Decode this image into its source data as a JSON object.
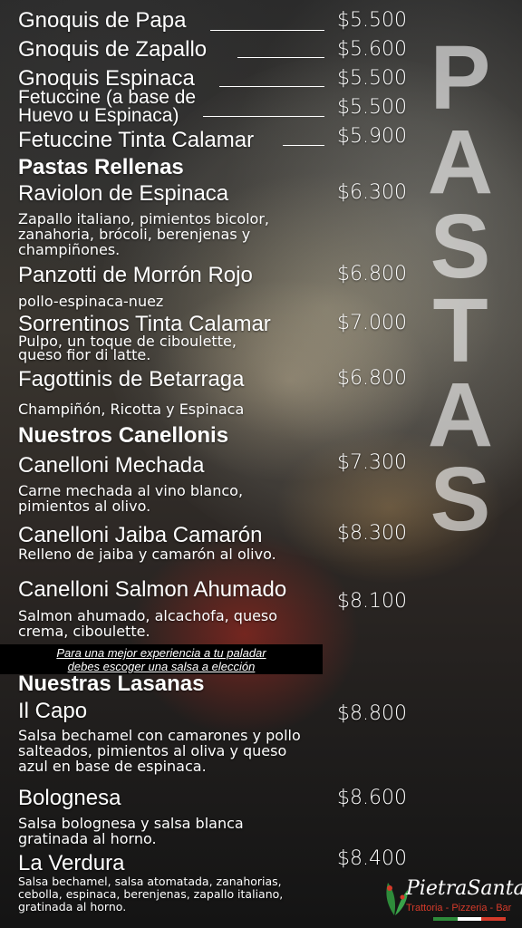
{
  "side_title": [
    "P",
    "A",
    "S",
    "T",
    "A",
    "S"
  ],
  "items": [
    {
      "name": "Gnoquis de Papa",
      "price": "$5.500"
    },
    {
      "name": "Gnoquis de Zapallo",
      "price": "$5.600"
    },
    {
      "name": "Gnoquis Espinaca",
      "price": "$5.500"
    },
    {
      "name": "Fetuccine (a base de\nHuevo u Espinaca)",
      "price": "$5.500"
    },
    {
      "name": "Fetuccine Tinta Calamar",
      "price": "$5.900"
    }
  ],
  "sections": {
    "rellenas": "Pastas Rellenas",
    "canellonis": "Nuestros Canellonis",
    "lasanas": "Nuestras Lasanas"
  },
  "rellenas_items": [
    {
      "name": "Raviolon de Espinaca",
      "price": "$6.300",
      "desc": "Zapallo italiano, pimientos bicolor,\nzanahoria, brócoli, berenjenas y\nchampiñones."
    },
    {
      "name": "Panzotti de Morrón Rojo",
      "price": "$6.800",
      "desc": "pollo-espinaca-nuez"
    },
    {
      "name": "Sorrentinos Tinta Calamar",
      "price": "$7.000",
      "desc": "Pulpo, un toque de ciboulette,\nqueso fior di latte."
    },
    {
      "name": "Fagottinis de Betarraga",
      "price": "$6.800",
      "desc": "Champiñón, Ricotta y Espinaca"
    }
  ],
  "canellonis_items": [
    {
      "name": "Canelloni Mechada",
      "price": "$7.300",
      "desc": "Carne mechada al vino blanco,\npimientos al olivo."
    },
    {
      "name": "Canelloni Jaiba Camarón",
      "price": "$8.300",
      "desc": "Relleno de jaiba y camarón al olivo."
    },
    {
      "name": "Canelloni Salmon Ahumado",
      "price": "$8.100",
      "desc": "Salmon ahumado, alcachofa, queso\ncrema, ciboulette."
    }
  ],
  "note": {
    "line1": "Para una mejor experiencia a tu paladar",
    "line2": "debes escoger una salsa a elección"
  },
  "lasanas_items": [
    {
      "name": "Il Capo",
      "price": "$8.800",
      "desc": "Salsa bechamel con camarones y pollo\nsalteados, pimientos al oliva y queso\nazul en base de espinaca."
    },
    {
      "name": "Bolognesa",
      "price": "$8.600",
      "desc": "Salsa bolognesa y salsa blanca\ngratinada al horno."
    },
    {
      "name": "La Verdura",
      "price": "$8.400",
      "desc": "Salsa bechamel, salsa atomatada, zanahorias,\ncebolla, espinaca, berenjenas, zapallo italiano,\ngratinada al horno."
    }
  ],
  "logo": {
    "word": "PietraSanta",
    "sub": "Trattoria - Pizzeria - Bar"
  },
  "colors": {
    "accent_red": "#d43a2a",
    "flag_green": "#2e8b3a",
    "flag_white": "#ffffff",
    "flag_red": "#d43a2a"
  }
}
